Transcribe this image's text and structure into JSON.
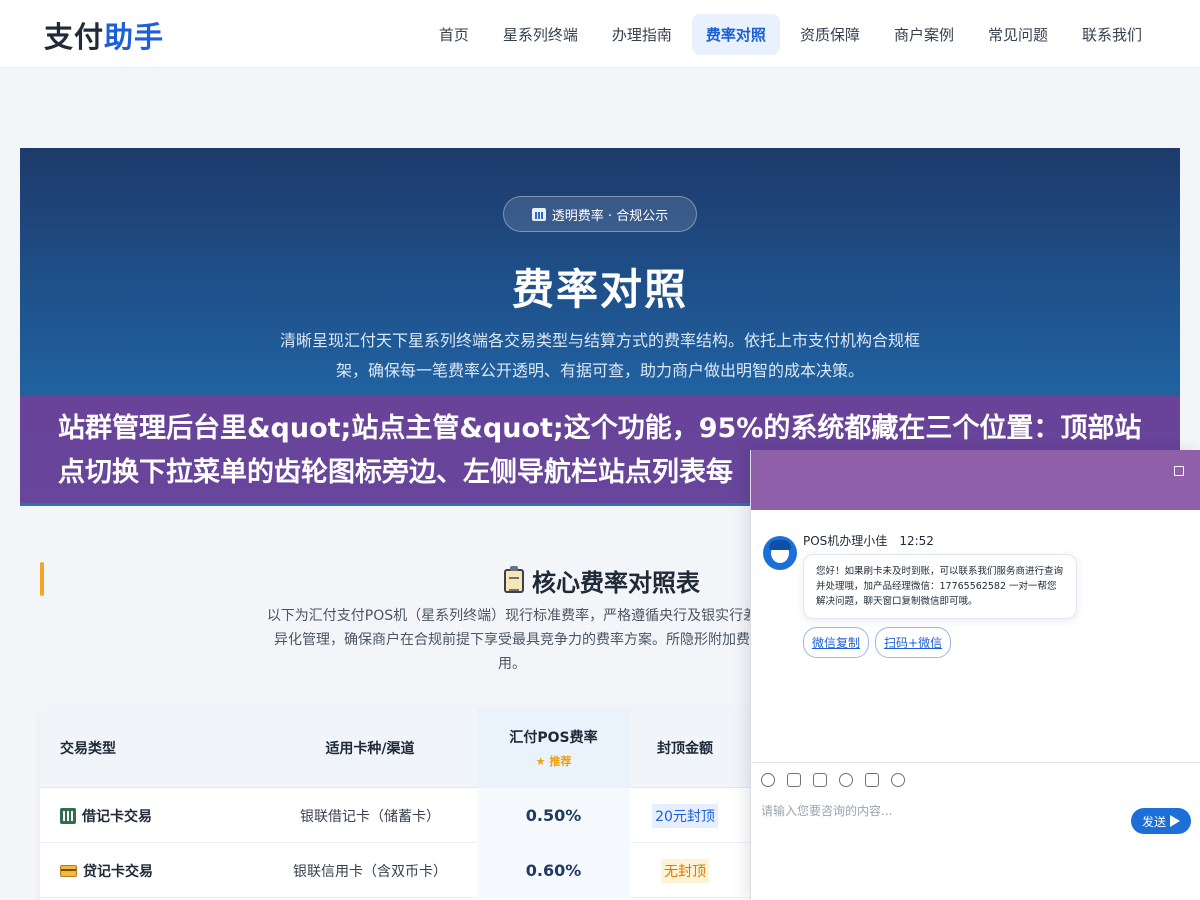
{
  "header": {
    "logo_part1": "支付",
    "logo_part2": "助手",
    "nav": [
      {
        "label": "首页"
      },
      {
        "label": "星系列终端"
      },
      {
        "label": "办理指南"
      },
      {
        "label": "费率对照",
        "active": true
      },
      {
        "label": "资质保障"
      },
      {
        "label": "商户案例"
      },
      {
        "label": "常见问题"
      },
      {
        "label": "联系我们"
      }
    ]
  },
  "hero": {
    "badge": "透明费率 · 合规公示",
    "title": "费率对照",
    "description": "清晰呈现汇付天下星系列终端各交易类型与结算方式的费率结构。依托上市支付机构合规框架，确保每一笔费率公开透明、有据可查，助力商户做出明智的成本决策。"
  },
  "banner": {
    "text": "站群管理后台里&quot;站点主管&quot;这个功能，95%的系统都藏在三个位置：顶部站点切换下拉菜单的齿轮图标旁边、左侧导航栏站点列表每"
  },
  "section": {
    "title": "核心费率对照表",
    "description": "以下为汇付支付POS机（星系列终端）现行标准费率，严格遵循央行及银实行差异化管理，确保商户在合规前提下享受最具竞争力的费率方案。所隐形附加费用。"
  },
  "table": {
    "headers": {
      "type": "交易类型",
      "channel": "适用卡种/渠道",
      "rate": "汇付POS费率",
      "rate_tag": "★ 推荐",
      "cap": "封顶金额"
    },
    "rows": [
      {
        "type": "借记卡交易",
        "channel": "银联借记卡（储蓄卡）",
        "rate": "0.50%",
        "cap": "20元封顶"
      },
      {
        "type": "贷记卡交易",
        "channel": "银联信用卡（含双币卡）",
        "rate": "0.60%",
        "cap": "无封顶"
      }
    ]
  },
  "chat": {
    "agent_name": "POS机办理小佳",
    "time": "12:52",
    "message": "您好！如果刷卡未及时到账，可以联系我们服务商进行查询并处理哦，加产品经理微信：17765562582 一对一帮您解决问题，聊天窗口复制微信即可哦。",
    "chips": [
      "微信复制",
      "扫码+微信"
    ],
    "input_placeholder": "请输入您要咨询的内容...",
    "send_label": "发送"
  },
  "colors": {
    "brand_blue": "#1d5fd8",
    "accent_orange": "#f5a623",
    "banner_purple": "#783c96"
  }
}
